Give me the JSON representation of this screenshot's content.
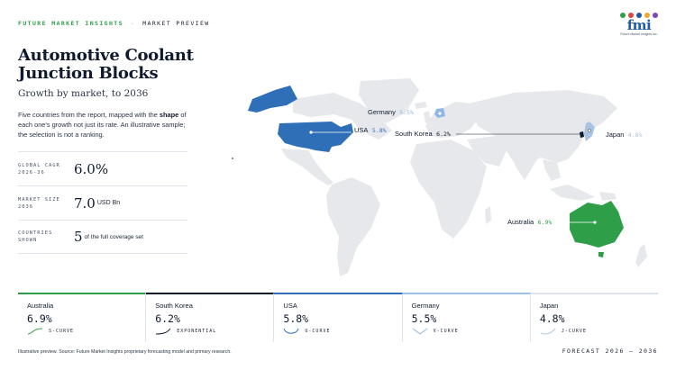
{
  "header": {
    "brand": "FUTURE MARKET INSIGHTS",
    "separator": "·",
    "section": "MARKET PREVIEW"
  },
  "logo": {
    "word": "fmi",
    "tagline": "Future Market Insights Inc.",
    "dot_colors": [
      "#2e9e48",
      "#e0453b",
      "#1f5aa8",
      "#f2a531",
      "#7a48b5"
    ]
  },
  "title": "Automotive Coolant Junction Blocks",
  "subtitle": "Growth by market, to 2036",
  "description": {
    "pre": "Five countries from the report, mapped with the ",
    "bold": "shape",
    "post": " of each one's growth not just its rate. An illustrative sample; the selection is not a ranking."
  },
  "stats": [
    {
      "label_line1": "GLOBAL CAGR",
      "label_line2": "2026-36",
      "value": "6.0%",
      "unit": ""
    },
    {
      "label_line1": "MARKET SIZE",
      "label_line2": "2036",
      "value": "7.0",
      "unit": "USD Bn"
    },
    {
      "label_line1": "COUNTRIES",
      "label_line2": "SHOWN",
      "value": "5",
      "unit": "of the full coverage set"
    }
  ],
  "map_labels": [
    {
      "country": "Germany",
      "rate": "5.5%",
      "color": "#8fb7e3"
    },
    {
      "country": "USA",
      "rate": "5.8%",
      "color": "#2f6fb7"
    },
    {
      "country": "South Korea",
      "rate": "6.2%",
      "color": "#0f1a2e"
    },
    {
      "country": "Japan",
      "rate": "4.8%",
      "color": "#a9c4e2"
    },
    {
      "country": "Australia",
      "rate": "6.9%",
      "color": "#2e9e48"
    }
  ],
  "cards": [
    {
      "country": "Australia",
      "rate": "6.9%",
      "shape": "S-CURVE",
      "color": "#2e9e48"
    },
    {
      "country": "South Korea",
      "rate": "6.2%",
      "shape": "EXPONENTIAL",
      "color": "#0f1a2e"
    },
    {
      "country": "USA",
      "rate": "5.8%",
      "shape": "U-CURVE",
      "color": "#2f6fb7"
    },
    {
      "country": "Germany",
      "rate": "5.5%",
      "shape": "V-CURVE",
      "color": "#8fb7e3"
    },
    {
      "country": "Japan",
      "rate": "4.8%",
      "shape": "J-CURVE",
      "color": "#b7cbe3"
    }
  ],
  "footer": "Illustrative preview. Source: Future Market Insights proprietary forecasting model and primary research.",
  "forecast": "FORECAST 2026 – 2036",
  "colors": {
    "land": "#e6e8ec",
    "usa": "#2f6fb7",
    "australia": "#2e9e48",
    "germany": "#8fb7e3",
    "japan": "#a9c4e2",
    "korea": "#0f1a2e"
  }
}
